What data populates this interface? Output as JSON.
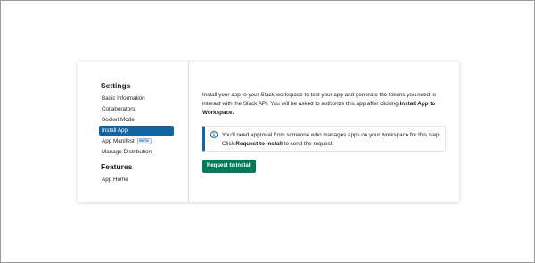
{
  "sidebar": {
    "settings_heading": "Settings",
    "settings_items": [
      {
        "label": "Basic Information",
        "active": false
      },
      {
        "label": "Collaborators",
        "active": false
      },
      {
        "label": "Socket Mode",
        "active": false
      },
      {
        "label": "Install App",
        "active": true
      },
      {
        "label": "App Manifest",
        "active": false,
        "badge": "BETA"
      },
      {
        "label": "Manage Distribution",
        "active": false
      }
    ],
    "features_heading": "Features",
    "features_items": [
      {
        "label": "App Home",
        "active": false
      }
    ]
  },
  "main": {
    "intro_text_1": "Install your app to your Slack workspace to test your app and generate the tokens you need to interact with the Slack API. You will be asked to authorize this app after clicking ",
    "intro_bold": "Install App to Workspace.",
    "notice": {
      "icon": "info-icon",
      "text_1": "You'll need approval from someone who manages apps on your workspace for this step. Click ",
      "bold": "Request to Install",
      "text_2": " to send the request."
    },
    "request_button_label": "Request to Install"
  },
  "colors": {
    "active_nav": "#1264a3",
    "button": "#007a5a",
    "notice_border": "#1264a3"
  }
}
